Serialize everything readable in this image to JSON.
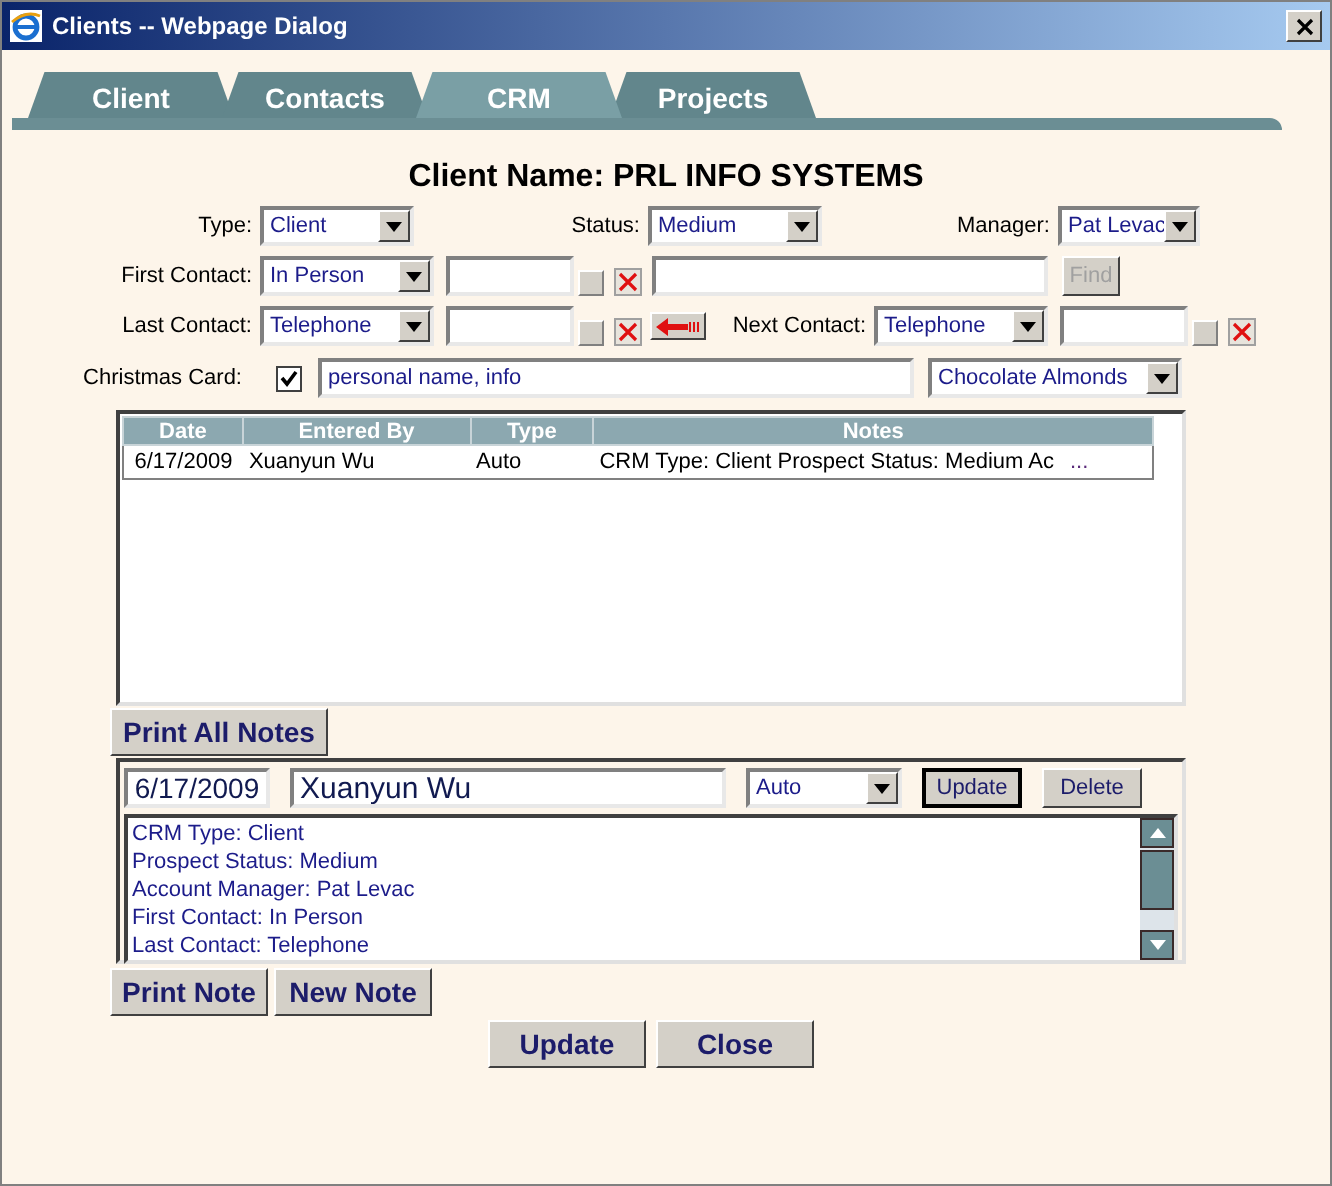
{
  "window": {
    "title": "Clients -- Webpage Dialog"
  },
  "tabs": [
    {
      "label": "Client",
      "selected": false
    },
    {
      "label": "Contacts",
      "selected": false
    },
    {
      "label": "CRM",
      "selected": true
    },
    {
      "label": "Projects",
      "selected": false
    }
  ],
  "client_name": "Client Name: PRL INFO SYSTEMS",
  "type": {
    "label": "Type:",
    "value": "Client"
  },
  "status": {
    "label": "Status:",
    "value": "Medium"
  },
  "manager": {
    "label": "Manager:",
    "value": "Pat Levac"
  },
  "first_contact": {
    "label": "First Contact:",
    "value": "In Person"
  },
  "find": {
    "label": "Find",
    "disabled": true
  },
  "last_contact": {
    "label": "Last Contact:",
    "value": "Telephone"
  },
  "next_contact": {
    "label": "Next Contact:",
    "value": "Telephone"
  },
  "christmas_card": {
    "label": "Christmas Card:",
    "checked": true,
    "value": "personal name, info",
    "gift": "Chocolate Almonds"
  },
  "notes_table": {
    "columns": [
      "Date",
      "Entered By",
      "Type",
      "Notes"
    ],
    "rows": [
      {
        "date": "6/17/2009",
        "entered_by": "Xuanyun Wu",
        "type": "Auto",
        "notes": "CRM Type: Client Prospect Status: Medium Ac",
        "more": "..."
      }
    ]
  },
  "print_all_notes": "Print All Notes",
  "editor": {
    "date": "6/17/2009",
    "entered_by": "Xuanyun Wu",
    "type": "Auto",
    "update": "Update",
    "delete": "Delete",
    "lines": [
      "CRM Type: Client",
      "Prospect Status: Medium",
      "Account Manager: Pat Levac",
      "First Contact: In Person",
      "Last Contact: Telephone"
    ]
  },
  "note_buttons": [
    "Print Note",
    "New Note"
  ],
  "buttons": [
    "Update",
    "Close"
  ]
}
